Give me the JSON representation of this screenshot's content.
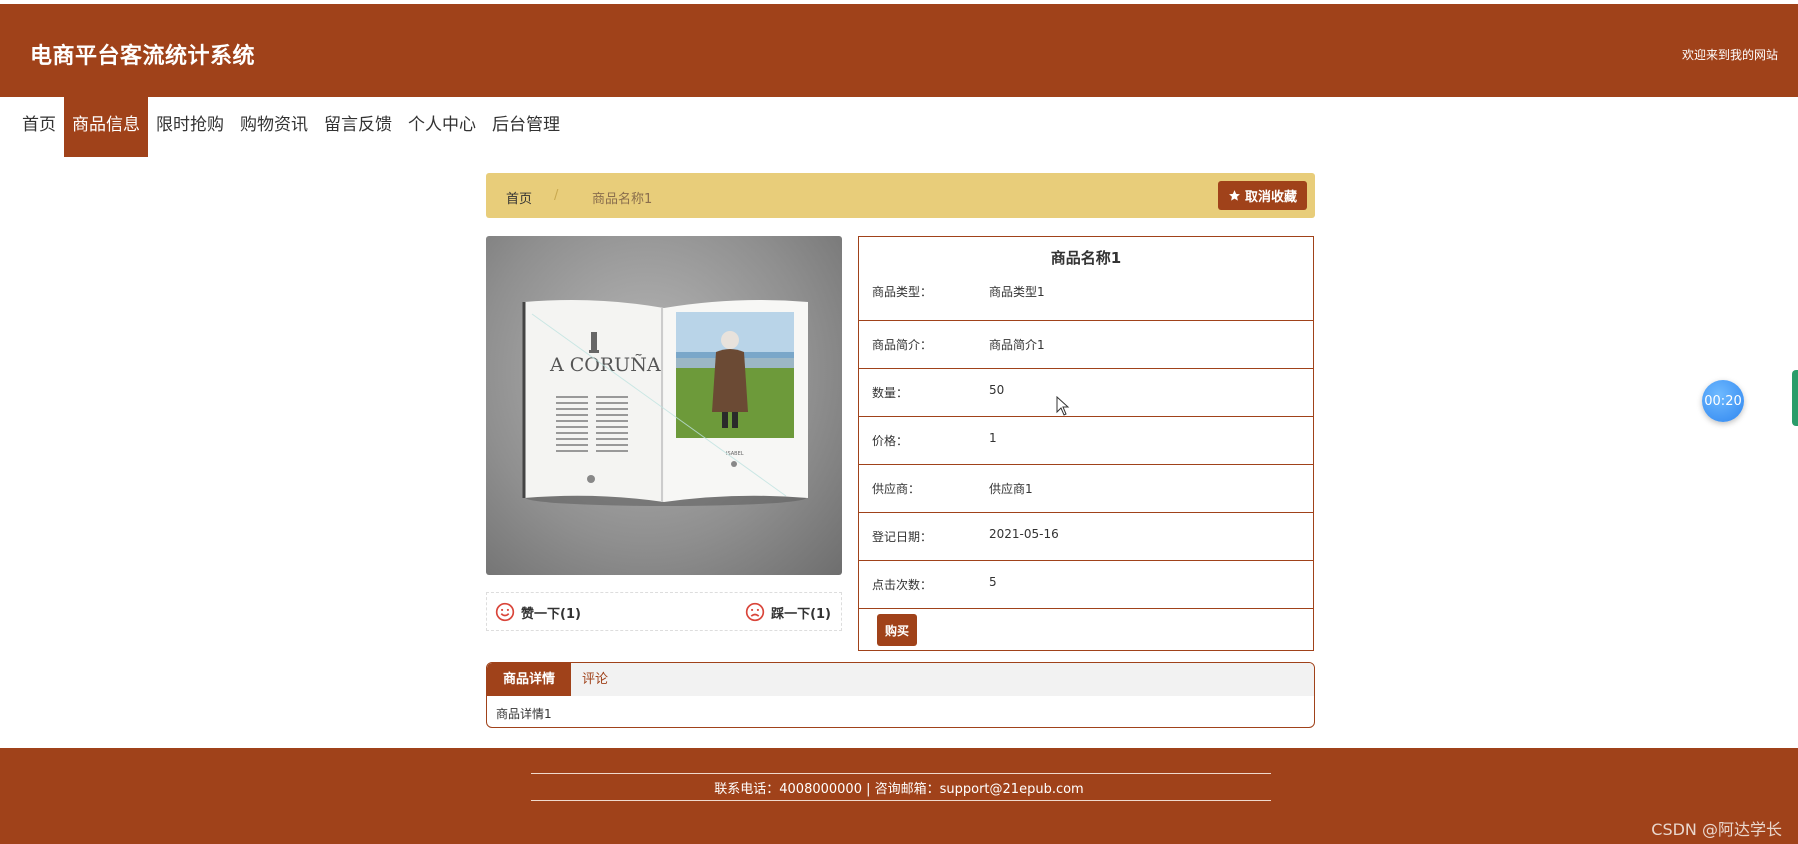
{
  "header": {
    "site_title": "电商平台客流统计系统",
    "welcome": "欢迎来到我的网站"
  },
  "nav": {
    "items": [
      {
        "label": "首页"
      },
      {
        "label": "商品信息"
      },
      {
        "label": "限时抢购"
      },
      {
        "label": "购物资讯"
      },
      {
        "label": "留言反馈"
      },
      {
        "label": "个人中心"
      },
      {
        "label": "后台管理"
      }
    ],
    "active": "商品信息"
  },
  "breadcrumb": {
    "home": "首页",
    "separator": "/",
    "current": "商品名称1"
  },
  "favorite_button": {
    "label": "取消收藏",
    "icon": "star-icon"
  },
  "product": {
    "title": "商品名称1",
    "image_alt": "book-open-spread-image",
    "rows": [
      {
        "label": "商品类型：",
        "value": "商品类型1"
      },
      {
        "label": "商品简介：",
        "value": "商品简介1"
      },
      {
        "label": "数量：",
        "value": "50"
      },
      {
        "label": "价格：",
        "value": "1"
      },
      {
        "label": "供应商：",
        "value": "供应商1"
      },
      {
        "label": "登记日期：",
        "value": "2021-05-16"
      },
      {
        "label": "点击次数：",
        "value": "5"
      }
    ],
    "buy_label": "购买"
  },
  "votes": {
    "up_label": "赞一下(1)",
    "down_label": "踩一下(1)"
  },
  "tabs": {
    "items": [
      {
        "label": "商品详情",
        "active": true
      },
      {
        "label": "评论",
        "active": false
      }
    ],
    "content": "商品详情1"
  },
  "timer": {
    "label": "00:20"
  },
  "footer": {
    "contact": "联系电话：4008000000 | 咨询邮箱：support@21epub.com"
  },
  "watermark": "CSDN @阿达学长",
  "colors": {
    "brand": "#a0421a",
    "breadcrumb_bg": "#e8cd7a",
    "timer": "#2f86f0"
  }
}
